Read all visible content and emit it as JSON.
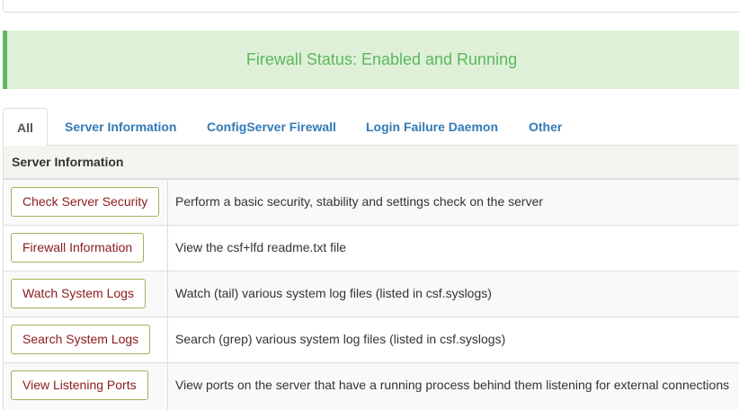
{
  "status": {
    "text": "Firewall Status: Enabled and Running"
  },
  "tabs": [
    {
      "label": "All",
      "active": true
    },
    {
      "label": "Server Information",
      "active": false
    },
    {
      "label": "ConfigServer Firewall",
      "active": false
    },
    {
      "label": "Login Failure Daemon",
      "active": false
    },
    {
      "label": "Other",
      "active": false
    }
  ],
  "section": {
    "title": "Server Information",
    "rows": [
      {
        "button": "Check Server Security",
        "description": "Perform a basic security, stability and settings check on the server"
      },
      {
        "button": "Firewall Information",
        "description": "View the csf+lfd readme.txt file"
      },
      {
        "button": "Watch System Logs",
        "description": "Watch (tail) various system log files (listed in csf.syslogs)"
      },
      {
        "button": "Search System Logs",
        "description": "Search (grep) various system log files (listed in csf.syslogs)"
      },
      {
        "button": "View Listening Ports",
        "description": "View ports on the server that have a running process behind them listening for external connections"
      }
    ]
  },
  "colors": {
    "status_text": "#5cb85c",
    "status_bg": "#dff0d8",
    "tab_link": "#337ab7",
    "button_text": "#8b1a1a",
    "button_border": "#a2b05a"
  }
}
